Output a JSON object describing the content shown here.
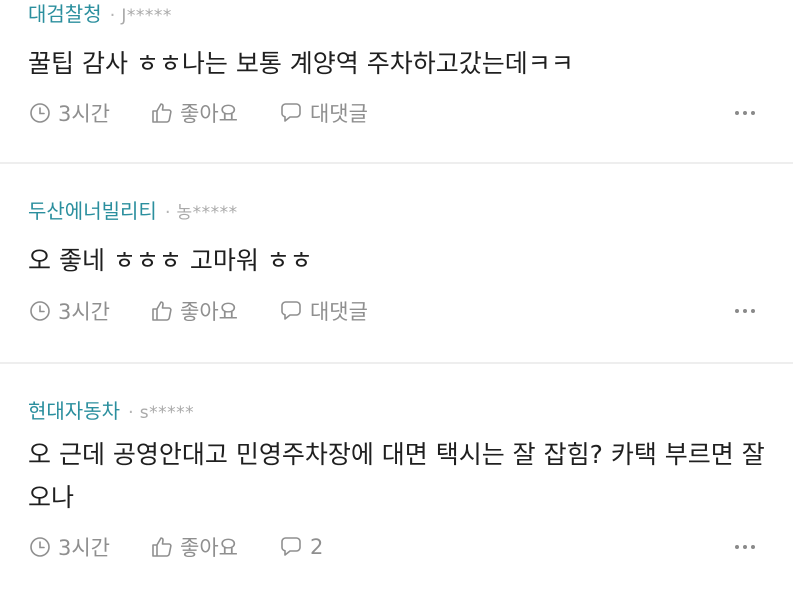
{
  "comments": [
    {
      "company": "대검찰청",
      "user": "J*****",
      "text": "꿀팁 감사 ㅎㅎ나는 보통 계양역 주차하고갔는데ㅋㅋ",
      "time": "3시간",
      "like_label": "좋아요",
      "reply_label": "대댓글"
    },
    {
      "company": "두산에너빌리티",
      "user": "농*****",
      "text": "오 좋네 ㅎㅎㅎ 고마워 ㅎㅎ",
      "time": "3시간",
      "like_label": "좋아요",
      "reply_label": "대댓글"
    },
    {
      "company": "현대자동차",
      "user": "s*****",
      "text": "오 근데 공영안대고 민영주차장에 대면 택시는 잘 잡힘? 카택 부르면 잘 오나",
      "time": "3시간",
      "like_label": "좋아요",
      "reply_label": "2"
    }
  ],
  "separator_dot": "·",
  "icons": {
    "time": "clock-icon",
    "like": "thumbs-up-icon",
    "reply": "speech-bubble-icon",
    "more": "more-dots-icon"
  },
  "colors": {
    "company": "#2b8f9e",
    "meta_gray": "#a9a9a9",
    "action_gray": "#8f8f8f"
  }
}
